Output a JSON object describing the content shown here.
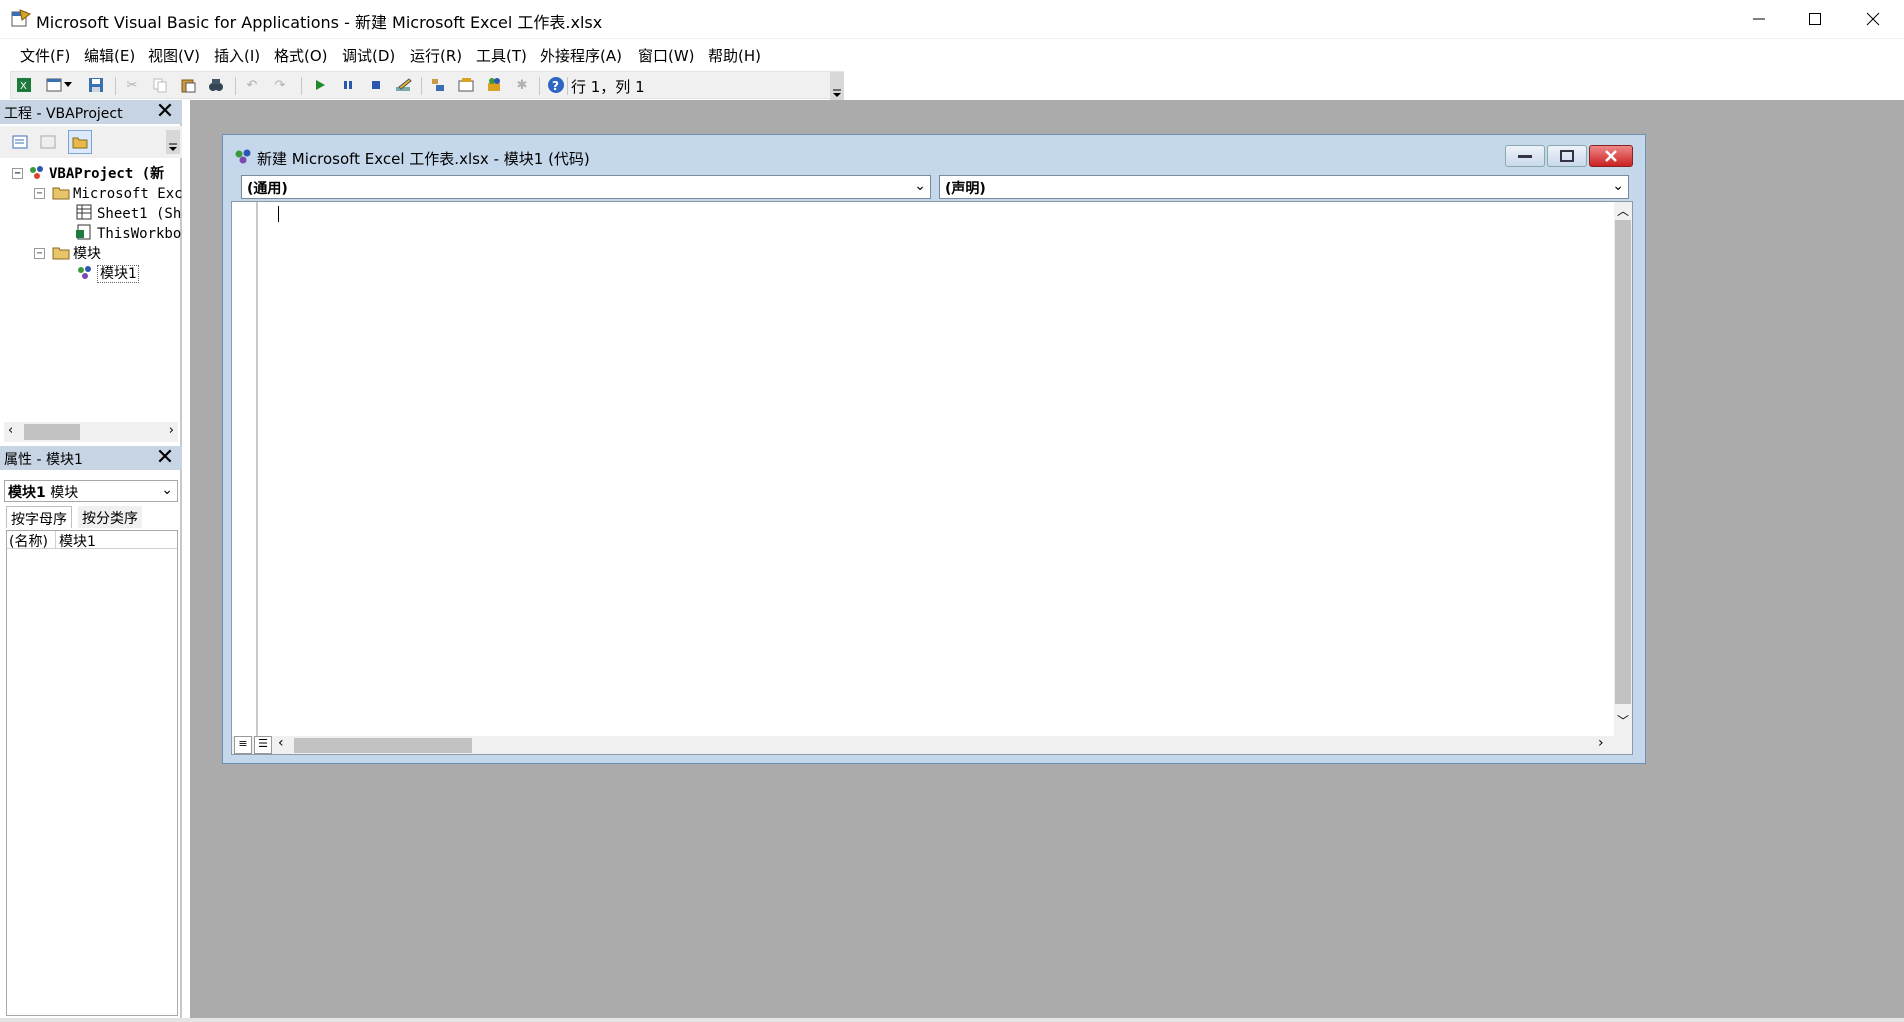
{
  "window": {
    "title": "Microsoft Visual Basic for Applications - 新建 Microsoft Excel 工作表.xlsx",
    "icon": "vba-app-icon"
  },
  "menu": [
    {
      "label": "文件(F)"
    },
    {
      "label": "编辑(E)"
    },
    {
      "label": "视图(V)"
    },
    {
      "label": "插入(I)"
    },
    {
      "label": "格式(O)"
    },
    {
      "label": "调试(D)"
    },
    {
      "label": "运行(R)"
    },
    {
      "label": "工具(T)"
    },
    {
      "label": "外接程序(A)"
    },
    {
      "label": "窗口(W)"
    },
    {
      "label": "帮助(H)"
    }
  ],
  "toolbar": {
    "position_text": "行 1，列 1",
    "icons": [
      "view-excel-icon",
      "insert-userform-icon",
      "dropdown-arrow-icon",
      "save-icon",
      "cut-icon",
      "copy-icon",
      "paste-icon",
      "find-icon",
      "undo-icon",
      "redo-icon",
      "run-icon",
      "break-icon",
      "reset-icon",
      "design-mode-icon",
      "project-explorer-icon",
      "properties-window-icon",
      "object-browser-icon",
      "toolbox-icon",
      "help-icon"
    ]
  },
  "project_pane": {
    "title": "工程 - VBAProject",
    "tree": [
      {
        "label": "VBAProject (新",
        "level": 0,
        "icon": "vbaproject-icon",
        "toggle": "⊟",
        "bold": true
      },
      {
        "label": "Microsoft Exc",
        "level": 1,
        "icon": "folder-icon",
        "toggle": "⊟"
      },
      {
        "label": "Sheet1 (Sh",
        "level": 2,
        "icon": "worksheet-icon"
      },
      {
        "label": "ThisWorkbo",
        "level": 2,
        "icon": "workbook-icon"
      },
      {
        "label": "模块",
        "level": 1,
        "icon": "folder-icon",
        "toggle": "⊟"
      },
      {
        "label": "模块1",
        "level": 2,
        "icon": "module-icon",
        "selected": true
      }
    ]
  },
  "properties_pane": {
    "title": "属性 - 模块1",
    "object_name": "模块1",
    "object_type": "模块",
    "tabs": [
      "按字母序",
      "按分类序"
    ],
    "rows": [
      {
        "name": "(名称)",
        "value": "模块1"
      }
    ]
  },
  "code_window": {
    "title": "新建 Microsoft Excel 工作表.xlsx - 模块1 (代码)",
    "object_combo": "(通用)",
    "procedure_combo": "(声明)",
    "code": ""
  },
  "colors": {
    "mdi_background": "#ababab",
    "pane_title": "#c7d4e3",
    "code_window_frame": "#c4d7eb"
  }
}
